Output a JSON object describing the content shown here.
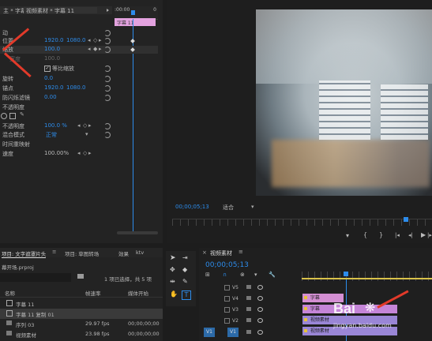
{
  "effect_controls": {
    "header_left": "主 * 字幕 11",
    "header_seq": "视频素材 * 字幕 11",
    "ruler_start": ":00:00",
    "ruler_end": "0",
    "clip_label": "字幕 11",
    "motion_label": "动",
    "position": {
      "label": "位置",
      "x": "1920.0",
      "y": "1080.0"
    },
    "scale": {
      "label": "缩放",
      "value": "100.0"
    },
    "scale_width": {
      "label": "宽度",
      "value": "100.0"
    },
    "uniform_scale": {
      "label": "等比缩放"
    },
    "rotation": {
      "label": "旋转",
      "value": "0.0"
    },
    "anchor": {
      "label": "锚点",
      "x": "1920.0",
      "y": "1080.0"
    },
    "anti_flicker": {
      "label": "防闪烁滤镜",
      "value": "0.00"
    },
    "opacity_section": "不透明度",
    "opacity": {
      "label": "不透明度",
      "value": "100.0 %"
    },
    "blend_mode": {
      "label": "混合模式",
      "value": "正常"
    },
    "time_remap": "时间重映射",
    "speed": {
      "label": "速度",
      "value": "100.00%"
    }
  },
  "program_monitor": {
    "timecode": "00;00;05;13",
    "fit": "适合",
    "controls": [
      "marker-in",
      "mark-in",
      "mark-out",
      "go-in",
      "step-back",
      "play",
      "step-forward"
    ]
  },
  "project_panel": {
    "tabs": [
      "项目: 文字遮罩片头",
      "项目: 草图转场",
      "效果",
      "ktv"
    ],
    "project_file": "幕开场.prproj",
    "selection_info": "1 项已选择，共 5 项",
    "columns": {
      "name": "名称",
      "fps": "帧速率",
      "media_start": "媒体开始"
    },
    "items": [
      {
        "name": "字幕 11",
        "fps": "",
        "start": ""
      },
      {
        "name": "字幕 11 复制 01",
        "fps": "",
        "start": ""
      },
      {
        "name": "序列 03",
        "fps": "29.97 fps",
        "start": "00;00;00;00"
      },
      {
        "name": "视频素材",
        "fps": "23.98 fps",
        "start": "00;00;00;00"
      }
    ]
  },
  "timeline": {
    "tab": "视频素材",
    "timecode": "00;00;05;13",
    "tracks": [
      {
        "id": "V5"
      },
      {
        "id": "V4"
      },
      {
        "id": "V3"
      },
      {
        "id": "V2"
      },
      {
        "id": "V1"
      }
    ],
    "clips": [
      "字幕",
      "字幕",
      "视频素材",
      "视频素材"
    ]
  },
  "watermark": {
    "brand": "Bai",
    "sub": "jingyan.baidu.com"
  },
  "colors": {
    "accent_blue": "#2d8ceb",
    "clip_pink": "#d48fd3",
    "clip_purple": "#9a86d6",
    "arrow_red": "#e23a2a"
  }
}
